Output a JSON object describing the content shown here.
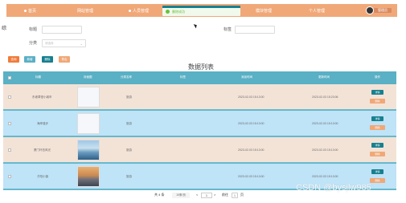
{
  "nav": {
    "items": [
      {
        "label": "首页"
      },
      {
        "label": "网站管理"
      },
      {
        "label": "人员管理"
      },
      {
        "label": "模块管理"
      },
      {
        "label": "个人管理"
      }
    ],
    "toast": "删除成功",
    "user_label": "管理员"
  },
  "search": {
    "title_label": "标题",
    "category_label": "分类",
    "category_placeholder": "请选择",
    "tag_label": "标签",
    "side_char": "综"
  },
  "buttons": {
    "search": "查询",
    "add": "新增",
    "delete": "删除",
    "export": "导出"
  },
  "table": {
    "title": "数据列表",
    "columns": [
      "标题",
      "封面图",
      "分类名称",
      "标签",
      "添加时间",
      "更新时间",
      "操作"
    ],
    "rows": [
      {
        "title": "东坡草堂小城市",
        "cover": "blank",
        "category": "旅游",
        "tag": "",
        "added": "2023-02-03 15:13:00",
        "updated": "2023-02-03 15:23:06"
      },
      {
        "title": "海岸漫步",
        "cover": "blank",
        "category": "旅游",
        "tag": "",
        "added": "2023-02-03 15:13:00",
        "updated": "2023-02-03 15:13:00"
      },
      {
        "title": "厦门环岛风光",
        "cover": "sea",
        "category": "旅游",
        "tag": "",
        "added": "2023-02-03 15:13:00",
        "updated": "2023-02-03 15:13:00"
      },
      {
        "title": "夕阳小镇",
        "cover": "sunset",
        "category": "旅游",
        "tag": "",
        "added": "2023-02-03 15:13:00",
        "updated": "2023-02-03 15:13:00"
      }
    ],
    "action_detail": "详情",
    "action_delete": "删除"
  },
  "pagination": {
    "total": "共 4 条",
    "page_size": "10条/页",
    "prev": "<",
    "current": "1",
    "next": ">",
    "goto": "前往",
    "goto_page": "1",
    "page_unit": "页"
  },
  "watermark": "CSDN @bysjlw985",
  "colors": {
    "nav": "#f0a878",
    "header": "#5ab0c4",
    "row_even": "#f3e3d7",
    "row_odd": "#bfe3f7",
    "accent": "#17808f"
  }
}
